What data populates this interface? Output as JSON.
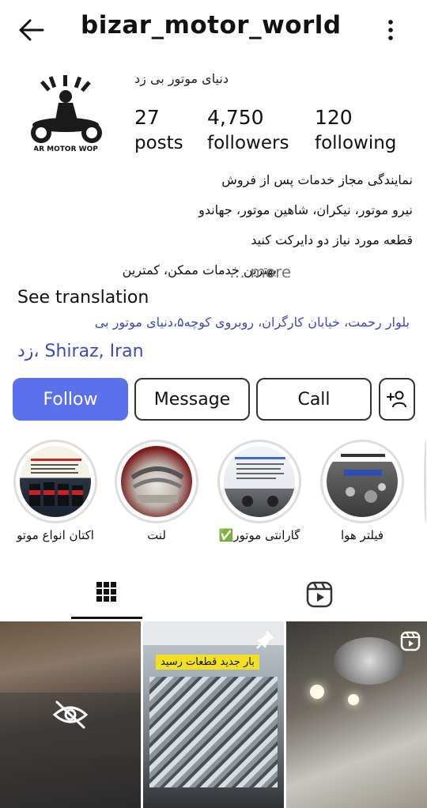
{
  "header": {
    "username": "bizar_motor_world",
    "back_icon": "arrow-left-icon",
    "menu_icon": "more-vertical-icon"
  },
  "profile": {
    "logo_text": "AR MOTOR WOP",
    "full_name": "دنیای موتور بی زد",
    "stats": {
      "posts": {
        "value": "27",
        "label": "posts"
      },
      "followers": {
        "value": "4,750",
        "label": "followers"
      },
      "following": {
        "value": "120",
        "label": "following"
      }
    },
    "bio": {
      "line1": "نمایندگی مجاز خدمات پس از فروش",
      "line2": "نیرو موتور، نیکران، شاهین موتور، جهاندو",
      "line3": "قطعه مورد نیاز دو دایرکت کنید",
      "line4": "بهترین خدمات ممکن، کمترین",
      "more": "… more",
      "see_translation": "See translation",
      "address_line1": "بلوار رحمت، خیابان کارگران، روبروی کوچه۵،دنیای موتور بی",
      "address_line2": "زد، Shiraz, Iran"
    }
  },
  "actions": {
    "follow": "Follow",
    "message": "Message",
    "call": "Call",
    "add_person_icon": "add-person-icon"
  },
  "highlights": [
    {
      "label": "اکتان انواع موتو"
    },
    {
      "label": "لنت"
    },
    {
      "label": "گارانتی موتور✅"
    },
    {
      "label": "فیلتر هوا"
    }
  ],
  "tabs": {
    "grid_icon": "grid-icon",
    "reels_icon": "reels-icon"
  },
  "posts": {
    "tile2_banner": "بار جدید قطعات رسید"
  },
  "colors": {
    "follow_button": "#5b71ec",
    "link": "#3b4bb8"
  }
}
